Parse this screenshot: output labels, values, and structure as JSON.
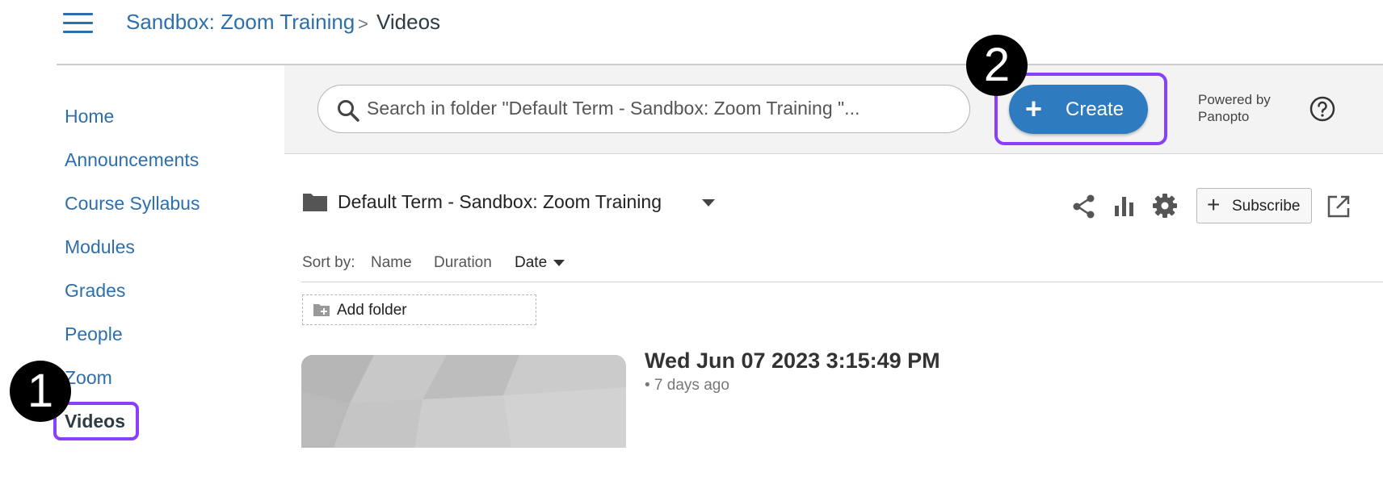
{
  "header": {
    "breadcrumb_course": "Sandbox: Zoom Training",
    "breadcrumb_separator": ">",
    "breadcrumb_page": "Videos"
  },
  "nav": {
    "items": [
      {
        "label": "Home",
        "active": false
      },
      {
        "label": "Announcements",
        "active": false
      },
      {
        "label": "Course Syllabus",
        "active": false
      },
      {
        "label": "Modules",
        "active": false
      },
      {
        "label": "Grades",
        "active": false
      },
      {
        "label": "People",
        "active": false
      },
      {
        "label": "Zoom",
        "active": false
      },
      {
        "label": "Videos",
        "active": true
      }
    ]
  },
  "toolbar": {
    "search_placeholder": "Search in folder \"Default Term - Sandbox: Zoom Training \"...",
    "create_label": "Create",
    "powered_by_line1": "Powered by",
    "powered_by_line2": "Panopto",
    "help_icon": "help-circle-icon"
  },
  "folder": {
    "name": "Default Term - Sandbox: Zoom Training",
    "subscribe_label": "Subscribe",
    "icons": [
      "share-icon",
      "stats-icon",
      "settings-icon",
      "open-external-icon"
    ]
  },
  "sort": {
    "label": "Sort by:",
    "options": [
      "Name",
      "Duration",
      "Date"
    ],
    "selected": "Date"
  },
  "add_folder_label": "Add folder",
  "videos": [
    {
      "title": "Wed Jun 07 2023 3:15:49 PM",
      "age": "• 7 days ago"
    }
  ],
  "annotations": {
    "step1": "1",
    "step2": "2"
  },
  "colors": {
    "link": "#2d6fab",
    "create_button": "#2e7bbf",
    "highlight": "#8a3ffc",
    "badge": "#000000"
  }
}
